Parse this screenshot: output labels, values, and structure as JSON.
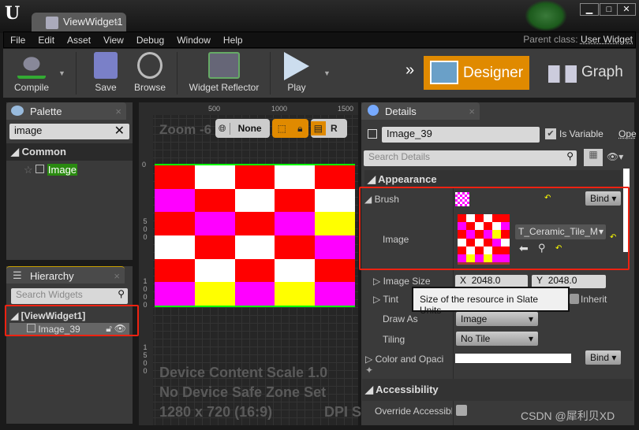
{
  "window": {
    "tab_title": "ViewWidget1",
    "tab_close": "×",
    "minimize": "▁",
    "maximize": "□",
    "close": "✕"
  },
  "menu": [
    "File",
    "Edit",
    "Asset",
    "View",
    "Debug",
    "Window",
    "Help"
  ],
  "parent_class": {
    "label": "Parent class:",
    "value": "User Widget"
  },
  "toolbar": {
    "compile": "Compile",
    "save": "Save",
    "browse": "Browse",
    "widget_reflector": "Widget Reflector",
    "play": "Play",
    "designer": "Designer",
    "graph": "Graph",
    "more": "»"
  },
  "palette": {
    "title": "Palette",
    "search_value": "image",
    "category": "Common",
    "item": "Image"
  },
  "hierarchy": {
    "title": "Hierarchy",
    "search_placeholder": "Search Widgets",
    "root": "[ViewWidget1]",
    "child": "Image_39"
  },
  "canvas": {
    "zoom": "Zoom -6",
    "ruler_x": [
      "500",
      "1000",
      "1500"
    ],
    "ruler_y": [
      "0",
      "500",
      "1000",
      "1500"
    ],
    "dpi_mode": "None",
    "toggle_r": "R",
    "overlay": [
      "Device Content Scale 1.0",
      "No Device Safe Zone Set",
      "1280 x 720 (16:9)"
    ],
    "dpi_label": "DPI S",
    "checker_rows": [
      [
        "#ff0000",
        "#ffffff",
        "#ff0000",
        "#ffffff",
        "#ff0000"
      ],
      [
        "#ff00ff",
        "#ff0000",
        "#ffffff",
        "#ff0000",
        "#ffffff"
      ],
      [
        "#ff0000",
        "#ff00ff",
        "#ff0000",
        "#ff00ff",
        "#ffff00"
      ],
      [
        "#ffffff",
        "#ff0000",
        "#ffffff",
        "#ff0000",
        "#ff00ff"
      ],
      [
        "#ff0000",
        "#ffffff",
        "#ff0000",
        "#ffffff",
        "#ff0000"
      ],
      [
        "#ff00ff",
        "#ffff00",
        "#ff00ff",
        "#ffff00",
        "#ff00ff"
      ]
    ]
  },
  "details": {
    "title": "Details",
    "name_value": "Image_39",
    "is_variable": "Is Variable",
    "is_variable_checked": true,
    "open": "Ope",
    "search_placeholder": "Search Details",
    "appearance": "Appearance",
    "brush": "Brush",
    "bind": "Bind",
    "image": "Image",
    "texture": "T_Ceramic_Tile_M",
    "image_size": "Image Size",
    "size_x_label": "X",
    "size_x": "2048.0",
    "size_y_label": "Y",
    "size_y": "2048.0",
    "tint": "Tint",
    "inherit": "Inherit",
    "tooltip": "Size of the resource in Slate Units",
    "draw_as": "Draw As",
    "draw_as_value": "Image",
    "tiling": "Tiling",
    "tiling_value": "No Tile",
    "color_opacity": "Color and Opaci",
    "accessibility": "Accessibility",
    "override_accessible": "Override Accessible"
  },
  "watermark": "CSDN @犀利贝XD",
  "accent_color": "#e08a00"
}
